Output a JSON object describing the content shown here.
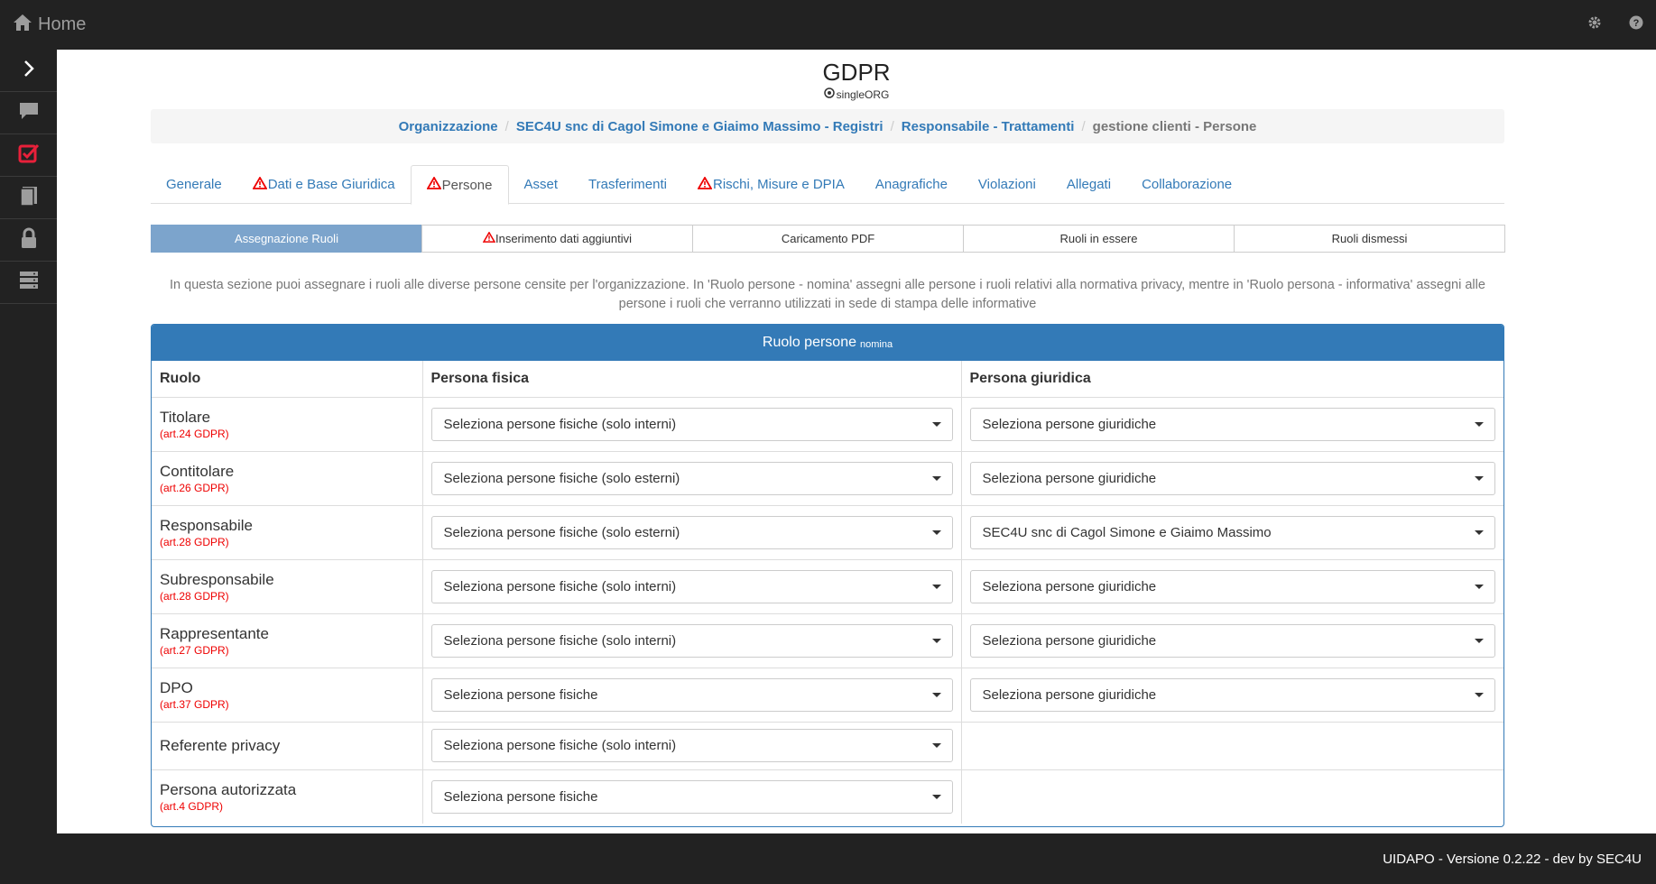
{
  "topbar": {
    "home_label": "Home",
    "icons": [
      "home-icon",
      "gear-icon",
      "help-icon"
    ]
  },
  "sidebar": {
    "icons": [
      "chevron-right-icon",
      "chat-icon",
      "checklist-icon",
      "book-icon",
      "lock-icon",
      "server-icon"
    ],
    "active_color": "#e8203a"
  },
  "header": {
    "title": "GDPR",
    "subtitle": "singleORG"
  },
  "breadcrumb": {
    "items": [
      "Organizzazione",
      "SEC4U snc di Cagol Simone e Giaimo Massimo - Registri",
      "Responsabile - Trattamenti"
    ],
    "current": "gestione clienti - Persone",
    "separator": "/"
  },
  "tabs": [
    {
      "label": "Generale",
      "warning": false
    },
    {
      "label": "Dati e Base Giuridica",
      "warning": true
    },
    {
      "label": "Persone",
      "warning": true,
      "active": true
    },
    {
      "label": "Asset",
      "warning": false
    },
    {
      "label": "Trasferimenti",
      "warning": false
    },
    {
      "label": "Rischi, Misure e DPIA",
      "warning": true
    },
    {
      "label": "Anagrafiche",
      "warning": false
    },
    {
      "label": "Violazioni",
      "warning": false
    },
    {
      "label": "Allegati",
      "warning": false
    },
    {
      "label": "Collaborazione",
      "warning": false
    }
  ],
  "subtabs": [
    {
      "label": "Assegnazione Ruoli",
      "active": true,
      "warning": false
    },
    {
      "label": "Inserimento dati aggiuntivi",
      "warning": true
    },
    {
      "label": "Caricamento PDF",
      "warning": false
    },
    {
      "label": "Ruoli in essere",
      "warning": false
    },
    {
      "label": "Ruoli dismessi",
      "warning": false
    }
  ],
  "description": "In questa sezione puoi assegnare i ruoli alle diverse persone censite per l'organizzazione. In 'Ruolo persone - nomina' assegni alle persone i ruoli relativi alla normativa privacy, mentre in 'Ruolo persona - informativa' assegni alle persone i ruoli che verranno utilizzati in sede di stampa delle informative",
  "panel": {
    "title": "Ruolo persone",
    "title_small": "nomina",
    "columns": [
      "Ruolo",
      "Persona fisica",
      "Persona giuridica"
    ],
    "rows": [
      {
        "role": "Titolare",
        "article": "(art.24 GDPR)",
        "fisica": "Seleziona persone fisiche (solo interni)",
        "giuridica": "Seleziona persone giuridiche"
      },
      {
        "role": "Contitolare",
        "article": "(art.26 GDPR)",
        "fisica": "Seleziona persone fisiche (solo esterni)",
        "giuridica": "Seleziona persone giuridiche"
      },
      {
        "role": "Responsabile",
        "article": "(art.28 GDPR)",
        "fisica": "Seleziona persone fisiche (solo esterni)",
        "giuridica": "SEC4U snc di Cagol Simone e Giaimo Massimo"
      },
      {
        "role": "Subresponsabile",
        "article": "(art.28 GDPR)",
        "fisica": "Seleziona persone fisiche (solo interni)",
        "giuridica": "Seleziona persone giuridiche"
      },
      {
        "role": "Rappresentante",
        "article": "(art.27 GDPR)",
        "fisica": "Seleziona persone fisiche (solo interni)",
        "giuridica": "Seleziona persone giuridiche"
      },
      {
        "role": "DPO",
        "article": "(art.37 GDPR)",
        "fisica": "Seleziona persone fisiche",
        "giuridica": "Seleziona persone giuridiche"
      },
      {
        "role": "Referente privacy",
        "article": "",
        "fisica": "Seleziona persone fisiche (solo interni)",
        "giuridica": ""
      },
      {
        "role": "Persona autorizzata",
        "article": "(art.4 GDPR)",
        "fisica": "Seleziona persone fisiche",
        "giuridica": ""
      }
    ]
  },
  "footer": {
    "text": "UIDAPO - Versione 0.2.22 - dev by SEC4U"
  },
  "colors": {
    "primary": "#337ab7",
    "warning": "#e00000",
    "subtab_active": "#7ca4cc",
    "chrome": "#222222"
  }
}
